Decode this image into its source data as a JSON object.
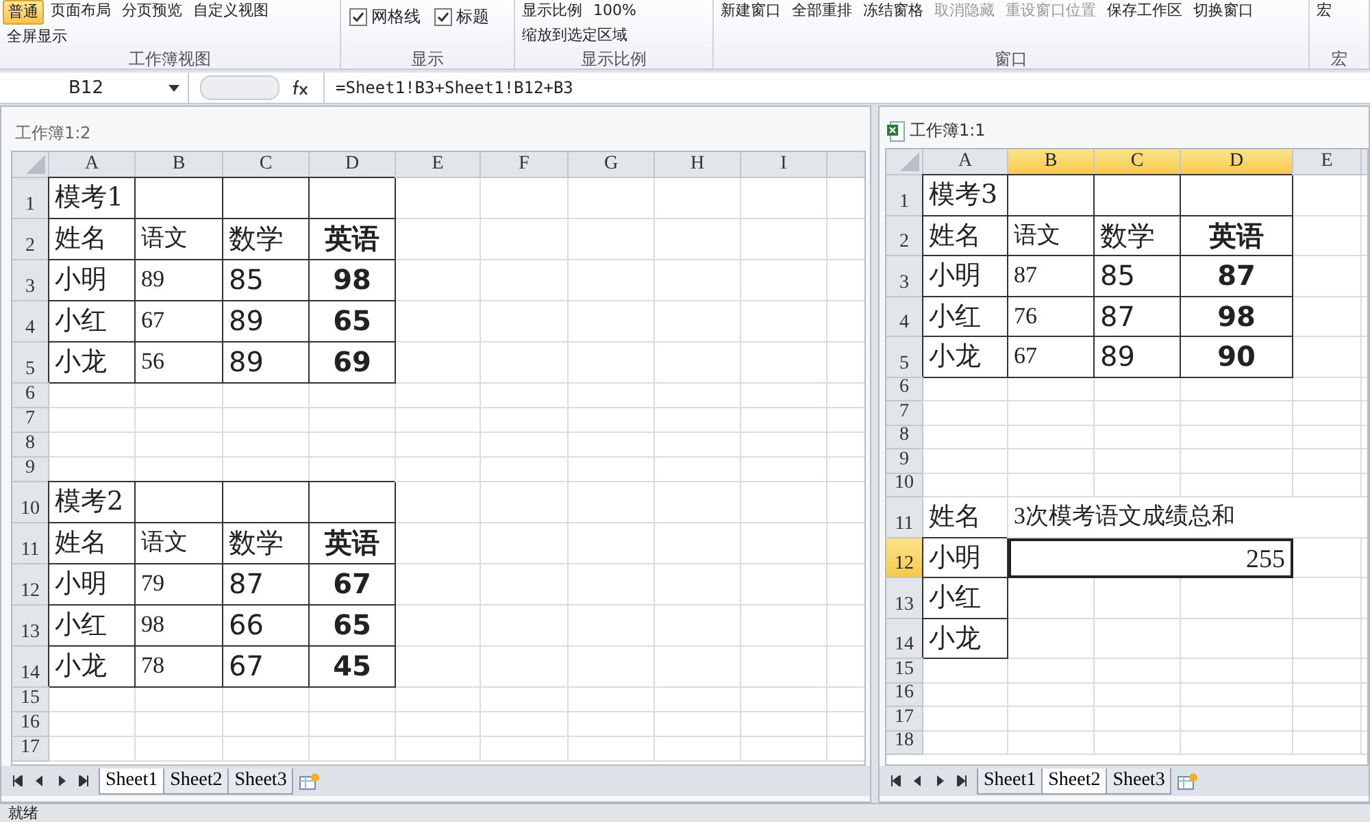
{
  "ribbon": {
    "groups": [
      {
        "label": "工作簿视图",
        "items": [
          {
            "kind": "big",
            "text": "普通",
            "selected": true,
            "disabled": false
          },
          {
            "kind": "big",
            "text": "页面布局",
            "selected": false,
            "disabled": false
          },
          {
            "kind": "big",
            "text": "分页预览",
            "selected": false,
            "disabled": false
          },
          {
            "kind": "big",
            "text": "自定义视图",
            "selected": false,
            "disabled": false
          },
          {
            "kind": "big",
            "text": "全屏显示",
            "selected": false,
            "disabled": false
          }
        ]
      },
      {
        "label": "显示",
        "items": [
          {
            "kind": "check",
            "text": "网格线",
            "checked": true
          },
          {
            "kind": "check",
            "text": "标题",
            "checked": true
          }
        ]
      },
      {
        "label": "显示比例",
        "items": [
          {
            "kind": "big",
            "text": "显示比例",
            "selected": false,
            "disabled": false
          },
          {
            "kind": "big",
            "text": "100%",
            "selected": false,
            "disabled": false
          },
          {
            "kind": "big",
            "text": "缩放到选定区域",
            "selected": false,
            "disabled": false
          }
        ]
      },
      {
        "label": "窗口",
        "items": [
          {
            "kind": "big",
            "text": "新建窗口",
            "selected": false,
            "disabled": false
          },
          {
            "kind": "big",
            "text": "全部重排",
            "selected": false,
            "disabled": false
          },
          {
            "kind": "big",
            "text": "冻结窗格",
            "selected": false,
            "disabled": false
          },
          {
            "kind": "small",
            "text": "取消隐藏",
            "disabled": true
          },
          {
            "kind": "small",
            "text": "重设窗口位置",
            "disabled": true
          },
          {
            "kind": "big",
            "text": "保存工作区",
            "selected": false,
            "disabled": false
          },
          {
            "kind": "big",
            "text": "切换窗口",
            "selected": false,
            "disabled": false
          }
        ]
      },
      {
        "label": "宏",
        "items": [
          {
            "kind": "big",
            "text": "宏",
            "selected": false,
            "disabled": false
          }
        ]
      }
    ]
  },
  "formula_bar": {
    "name_box": "B12",
    "formula": "=Sheet1!B3+Sheet1!B12+B3"
  },
  "panes": [
    {
      "title": "工作簿1:2",
      "columns": [
        {
          "label": "A",
          "selected": false
        },
        {
          "label": "B",
          "selected": false
        },
        {
          "label": "C",
          "selected": false
        },
        {
          "label": "D",
          "selected": false
        },
        {
          "label": "E",
          "selected": false
        },
        {
          "label": "F",
          "selected": false
        },
        {
          "label": "G",
          "selected": false
        },
        {
          "label": "H",
          "selected": false
        },
        {
          "label": "I",
          "selected": false
        }
      ],
      "rows": [
        {
          "number": "1",
          "selected": false,
          "cells": [
            {
              "text": "模考1",
              "bordered": true
            },
            {
              "bordered": true
            },
            {
              "bordered": true
            },
            {
              "bordered": true
            }
          ]
        },
        {
          "number": "2",
          "selected": false,
          "cells": [
            {
              "text": "姓名",
              "bordered": true
            },
            {
              "text": "语文",
              "bordered": true
            },
            {
              "text": "数学",
              "bordered": true
            },
            {
              "text": "英语",
              "bordered": true
            }
          ]
        },
        {
          "number": "3",
          "selected": false,
          "cells": [
            {
              "text": "小明",
              "bordered": true
            },
            {
              "text": "89",
              "bordered": true
            },
            {
              "text": "85",
              "bordered": true
            },
            {
              "text": "98",
              "bordered": true
            }
          ]
        },
        {
          "number": "4",
          "selected": false,
          "cells": [
            {
              "text": "小红",
              "bordered": true
            },
            {
              "text": "67",
              "bordered": true
            },
            {
              "text": "89",
              "bordered": true
            },
            {
              "text": "65",
              "bordered": true
            }
          ]
        },
        {
          "number": "5",
          "selected": false,
          "cells": [
            {
              "text": "小龙",
              "bordered": true
            },
            {
              "text": "56",
              "bordered": true
            },
            {
              "text": "89",
              "bordered": true
            },
            {
              "text": "69",
              "bordered": true
            }
          ]
        },
        {
          "number": "6",
          "selected": false,
          "cells": []
        },
        {
          "number": "7",
          "selected": false,
          "cells": []
        },
        {
          "number": "8",
          "selected": false,
          "cells": []
        },
        {
          "number": "9",
          "selected": false,
          "cells": []
        },
        {
          "number": "10",
          "selected": false,
          "cells": [
            {
              "text": "模考2",
              "bordered": true
            },
            {
              "bordered": true
            },
            {
              "bordered": true
            },
            {
              "bordered": true
            }
          ]
        },
        {
          "number": "11",
          "selected": false,
          "cells": [
            {
              "text": "姓名",
              "bordered": true
            },
            {
              "text": "语文",
              "bordered": true
            },
            {
              "text": "数学",
              "bordered": true
            },
            {
              "text": "英语",
              "bordered": true
            }
          ]
        },
        {
          "number": "12",
          "selected": false,
          "cells": [
            {
              "text": "小明",
              "bordered": true
            },
            {
              "text": "79",
              "bordered": true
            },
            {
              "text": "87",
              "bordered": true
            },
            {
              "text": "67",
              "bordered": true
            }
          ]
        },
        {
          "number": "13",
          "selected": false,
          "cells": [
            {
              "text": "小红",
              "bordered": true
            },
            {
              "text": "98",
              "bordered": true
            },
            {
              "text": "66",
              "bordered": true
            },
            {
              "text": "65",
              "bordered": true
            }
          ]
        },
        {
          "number": "14",
          "selected": false,
          "cells": [
            {
              "text": "小龙",
              "bordered": true
            },
            {
              "text": "78",
              "bordered": true
            },
            {
              "text": "67",
              "bordered": true
            },
            {
              "text": "45",
              "bordered": true
            }
          ]
        },
        {
          "number": "15",
          "selected": false,
          "cells": []
        },
        {
          "number": "16",
          "selected": false,
          "cells": []
        },
        {
          "number": "17",
          "selected": false,
          "cells": []
        }
      ],
      "sheets": [
        {
          "label": "Sheet1",
          "selected": true
        },
        {
          "label": "Sheet2",
          "selected": false
        },
        {
          "label": "Sheet3",
          "selected": false
        }
      ]
    },
    {
      "title": "工作簿1:1",
      "columns": [
        {
          "label": "A",
          "selected": false
        },
        {
          "label": "B",
          "selected": true
        },
        {
          "label": "C",
          "selected": true
        },
        {
          "label": "D",
          "selected": true
        },
        {
          "label": "E",
          "selected": false
        }
      ],
      "rows": [
        {
          "number": "1",
          "selected": false,
          "cells": [
            {
              "text": "模考3",
              "bordered": true
            },
            {
              "bordered": true
            },
            {
              "bordered": true
            },
            {
              "bordered": true
            }
          ]
        },
        {
          "number": "2",
          "selected": false,
          "cells": [
            {
              "text": "姓名",
              "bordered": true
            },
            {
              "text": "语文",
              "bordered": true
            },
            {
              "text": "数学",
              "bordered": true
            },
            {
              "text": "英语",
              "bordered": true
            }
          ]
        },
        {
          "number": "3",
          "selected": false,
          "cells": [
            {
              "text": "小明",
              "bordered": true
            },
            {
              "text": "87",
              "bordered": true
            },
            {
              "text": "85",
              "bordered": true
            },
            {
              "text": "87",
              "bordered": true
            }
          ]
        },
        {
          "number": "4",
          "selected": false,
          "cells": [
            {
              "text": "小红",
              "bordered": true
            },
            {
              "text": "76",
              "bordered": true
            },
            {
              "text": "87",
              "bordered": true
            },
            {
              "text": "98",
              "bordered": true
            }
          ]
        },
        {
          "number": "5",
          "selected": false,
          "cells": [
            {
              "text": "小龙",
              "bordered": true
            },
            {
              "text": "67",
              "bordered": true
            },
            {
              "text": "89",
              "bordered": true
            },
            {
              "text": "90",
              "bordered": true
            }
          ]
        },
        {
          "number": "6",
          "selected": false,
          "cells": []
        },
        {
          "number": "7",
          "selected": false,
          "cells": []
        },
        {
          "number": "8",
          "selected": false,
          "cells": []
        },
        {
          "number": "9",
          "selected": false,
          "cells": []
        },
        {
          "number": "10",
          "selected": false,
          "cells": []
        },
        {
          "number": "11",
          "selected": false,
          "cells": [
            {
              "text": "姓名",
              "bordered": false
            },
            {
              "text": "3次模考语文成绩总和",
              "bordered": false
            }
          ]
        },
        {
          "number": "12",
          "selected": true,
          "cells": [
            {
              "text": "小明",
              "bordered": true
            },
            {
              "text": "255",
              "bordered": true,
              "merged": true,
              "active": true
            }
          ]
        },
        {
          "number": "13",
          "selected": false,
          "cells": [
            {
              "text": "小红",
              "bordered": true
            }
          ]
        },
        {
          "number": "14",
          "selected": false,
          "cells": [
            {
              "text": "小龙",
              "bordered": true
            }
          ]
        },
        {
          "number": "15",
          "selected": false,
          "cells": []
        },
        {
          "number": "16",
          "selected": false,
          "cells": []
        },
        {
          "number": "17",
          "selected": false,
          "cells": []
        },
        {
          "number": "18",
          "selected": false,
          "cells": []
        }
      ],
      "sheets": [
        {
          "label": "Sheet1",
          "selected": false
        },
        {
          "label": "Sheet2",
          "selected": true
        },
        {
          "label": "Sheet3",
          "selected": false
        }
      ]
    }
  ],
  "status_bar": {
    "text": "就绪"
  }
}
